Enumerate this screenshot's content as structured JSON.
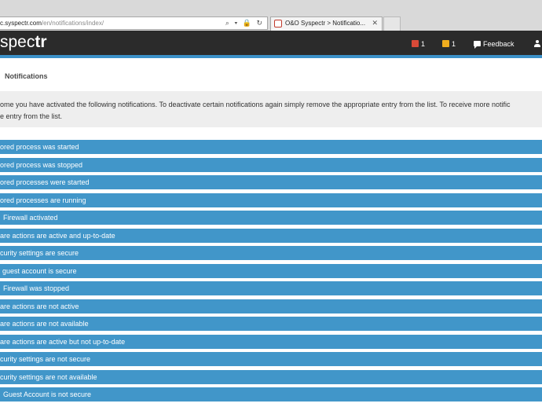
{
  "browser": {
    "address": {
      "domain": "c.syspectr.com",
      "path": "/en/notifications/index/",
      "icons": "⌕ ▾ 🔒 ↻"
    },
    "tab": {
      "title": "O&O Syspectr > Notificatio...",
      "close": "✕"
    }
  },
  "navbar": {
    "logo_light": "spec",
    "logo_bold": "tr",
    "alerts_count": "1",
    "warnings_count": "1",
    "feedback_label": "Feedback"
  },
  "page": {
    "title": "Notifications",
    "info_line1": "ome you have activated the following notifications. To deactivate certain notifications again simply remove the appropriate entry from the list. To receive more notific",
    "info_line2": "e entry from the list."
  },
  "notifications": [
    "ored process was started",
    "ored process was stopped",
    "ored processes were started",
    "ored processes are running",
    "Firewall activated",
    "are actions are active and up-to-date",
    "curity settings are secure",
    "guest account is secure",
    "Firewall was stopped",
    "are actions are not active",
    "are actions are not available",
    "are actions are active but not up-to-date",
    "curity settings are not secure",
    "curity settings are not available",
    "Guest Account is not secure"
  ],
  "colors": {
    "row": "#4196c9",
    "navbar": "#2b2b2b",
    "accent": "#3c91c8"
  }
}
